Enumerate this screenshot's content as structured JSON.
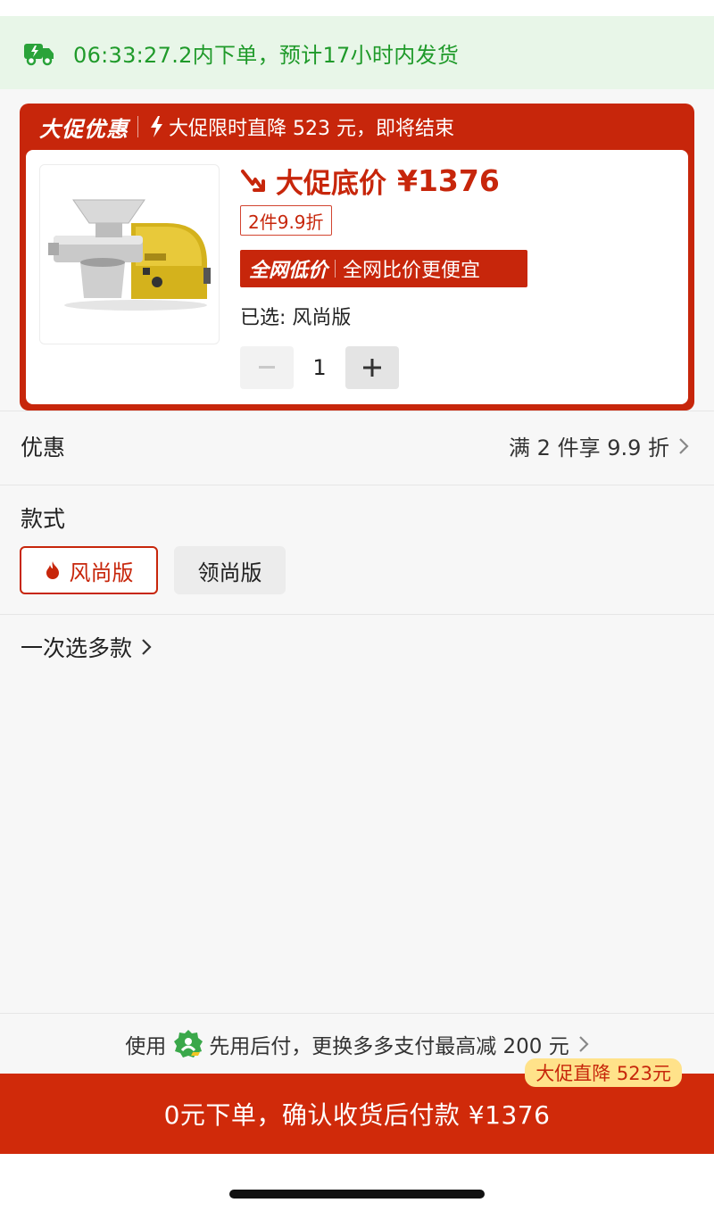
{
  "shipping": {
    "message": "06:33:27.2内下单，预计17小时内发货",
    "icon": "delivery-truck-icon"
  },
  "promo": {
    "title": "大促优惠",
    "subtitle": "大促限时直降 523 元，即将结束",
    "price_label": "大促底价",
    "price_value": "¥1376",
    "discount_tag": "2件9.9折",
    "lowest_title": "全网低价",
    "lowest_text": "全网比价更便宜",
    "selected": "已选: 风尚版",
    "quantity": "1"
  },
  "discount": {
    "label": "优惠",
    "value": "满 2 件享 9.9 折"
  },
  "style": {
    "label": "款式",
    "options": [
      {
        "label": "风尚版",
        "selected": true
      },
      {
        "label": "领尚版",
        "selected": false
      }
    ]
  },
  "multi_select": "一次选多款",
  "pay_hint": {
    "prefix": "使用",
    "text": "先用后付，更换多多支付最高减 200 元"
  },
  "cta": {
    "label": "0元下单，确认收货后付款 ¥1376",
    "badge": "大促直降 523元"
  },
  "colors": {
    "brand_red": "#c7260b",
    "ship_green": "#1f9a2a"
  }
}
